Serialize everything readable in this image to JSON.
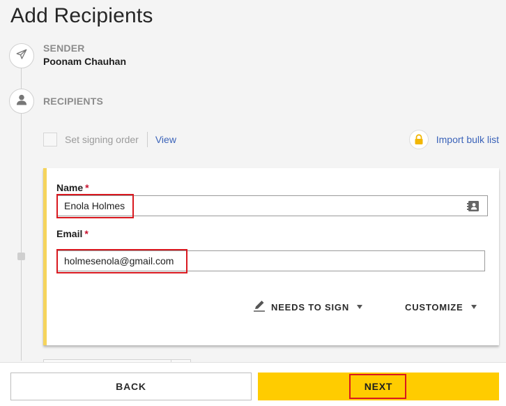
{
  "page": {
    "title": "Add Recipients"
  },
  "steps": {
    "sender": {
      "label": "SENDER",
      "name": "Poonam Chauhan",
      "icon": "send-icon"
    },
    "recipients": {
      "label": "RECIPIENTS",
      "icon": "person-icon"
    }
  },
  "order": {
    "checkbox_label": "Set signing order",
    "view_link": "View",
    "checked": false
  },
  "import": {
    "label": "Import bulk list",
    "icon": "lock-icon"
  },
  "recipient": {
    "name_label": "Name",
    "name_value": "Enola Holmes",
    "email_label": "Email",
    "email_value": "holmesenola@gmail.com",
    "required_mark": "*",
    "role": "NEEDS TO SIGN",
    "customize": "CUSTOMIZE"
  },
  "footer": {
    "back_label": "BACK",
    "next_label": "NEXT"
  },
  "colors": {
    "accent_yellow": "#ffcc00",
    "card_border": "#f5d45c",
    "link_blue": "#3b63b9",
    "required_red": "#c8102e",
    "highlight_red": "#d9181f"
  }
}
